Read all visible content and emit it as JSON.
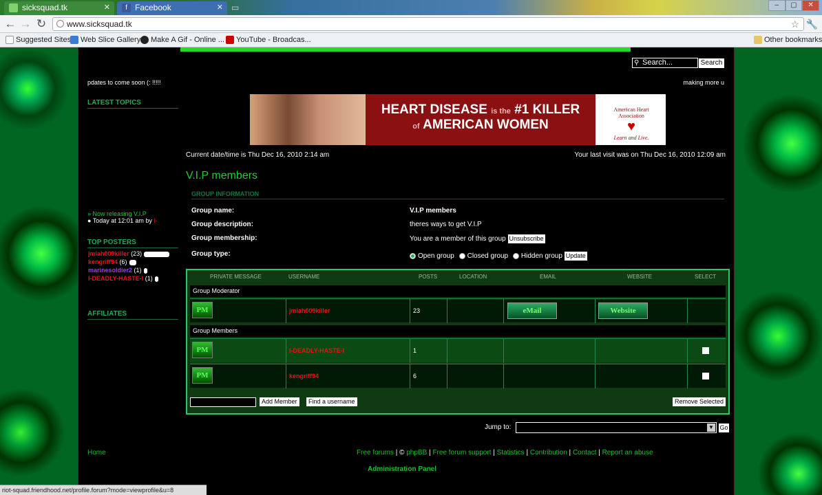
{
  "browser": {
    "tabs": [
      {
        "label": "sicksquad.tk",
        "favicon_color": "#7fd36a"
      },
      {
        "label": "Facebook",
        "favicon_color": "#3b5998"
      }
    ],
    "url": "www.sicksquad.tk",
    "bookmarks": [
      {
        "label": "Suggested Sites",
        "icon": "page-icon"
      },
      {
        "label": "Web Slice Gallery",
        "icon": "ie-icon"
      },
      {
        "label": "Make A Gif - Online ...",
        "icon": "gif-icon"
      },
      {
        "label": "YouTube - Broadcas...",
        "icon": "youtube-icon"
      }
    ],
    "other_bookmarks": "Other bookmarks",
    "status_bar": "riot-squad.friendhood.net/profile.forum?mode=viewprofile&u=8"
  },
  "search": {
    "placeholder": "Search...",
    "button": "Search"
  },
  "marquee": {
    "left": "pdates to come soon (: !!!!!",
    "right": "making more u"
  },
  "sidebar": {
    "latest_topics_title": "LATEST TOPICS",
    "latest_topic": {
      "title": "» Now releasing V.I.P",
      "meta": "Today at 12:01 am by",
      "author": "I-"
    },
    "top_posters_title": "TOP POSTERS",
    "top_posters": [
      {
        "name": "jmiah009killer",
        "count": "(23)",
        "color": "#e11",
        "share": 1.0
      },
      {
        "name": "kengriff94",
        "count": "(6)",
        "color": "#e11",
        "share": 0.26
      },
      {
        "name": "marinesoldier2",
        "count": "(1)",
        "color": "#a3f",
        "share": 0.04
      },
      {
        "name": "I-DEADLY-HASTE-I",
        "count": "(1)",
        "color": "#e11",
        "share": 0.04
      }
    ],
    "affiliates_title": "AFFILIATES"
  },
  "banner": {
    "line1a": "HEART DISEASE",
    "line1b": "is the",
    "line1c": "#1 KILLER",
    "line2a": "of",
    "line2b": "AMERICAN WOMEN",
    "org1": "American Heart",
    "org2": "Association",
    "tagline": "Learn and Live."
  },
  "dates": {
    "current": "Current date/time is Thu Dec 16, 2010 2:14 am",
    "last_visit": "Your last visit was on Thu Dec 16, 2010 12:09 am"
  },
  "group": {
    "title": "V.I.P members",
    "info_heading": "GROUP INFORMATION",
    "name_label": "Group name:",
    "name_value": "V.I.P members",
    "desc_label": "Group description:",
    "desc_value": "theres ways to get V.I.P",
    "membership_label": "Group membership:",
    "membership_value": "You are a member of this group",
    "unsubscribe": "Unsubscribe",
    "type_label": "Group type:",
    "type_options": [
      "Open group",
      "Closed group",
      "Hidden group"
    ],
    "update": "Update"
  },
  "members_table": {
    "columns": [
      "PRIVATE MESSAGE",
      "USERNAME",
      "POSTS",
      "LOCATION",
      "EMAIL",
      "WEBSITE",
      "SELECT"
    ],
    "moderator_label": "Group Moderator",
    "members_label": "Group Members",
    "pm_label": "PM",
    "email_label": "eMail",
    "website_label": "Website",
    "moderator": {
      "username": "jmiah009killer",
      "posts": "23"
    },
    "members": [
      {
        "username": "I-DEADLY-HASTE-I",
        "posts": "1"
      },
      {
        "username": "kengriff94",
        "posts": "6"
      }
    ],
    "add_member": "Add Member",
    "find_username": "Find a username",
    "remove_selected": "Remove Selected"
  },
  "jump": {
    "label": "Jump to:",
    "go": "Go"
  },
  "footer": {
    "home": "Home",
    "links": [
      "Free forums",
      "©",
      "phpBB",
      "Free forum support",
      "Statistics",
      "Contribution",
      "Contact",
      "Report an abuse"
    ],
    "admin": "Administration Panel"
  }
}
